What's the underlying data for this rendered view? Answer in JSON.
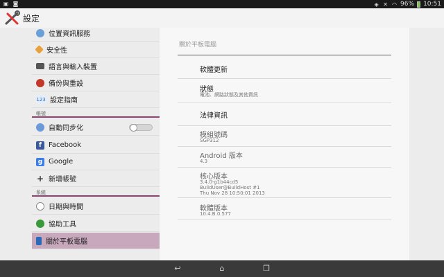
{
  "status_bar": {
    "battery_percent": "96%",
    "time": "10:51",
    "battery_level": 0.96
  },
  "action_bar": {
    "title": "設定",
    "icon": "settings-tools-icon"
  },
  "sidebar": {
    "items_top": [
      {
        "label": "位置資訊服務",
        "icon": "location-icon"
      },
      {
        "label": "安全性",
        "icon": "security-icon"
      },
      {
        "label": "語言與輸入裝置",
        "icon": "keyboard-icon"
      },
      {
        "label": "備份與重設",
        "icon": "backup-icon"
      },
      {
        "label": "設定指南",
        "icon": "guide-icon",
        "icon_text": "123"
      }
    ],
    "accounts_header": "帳號",
    "auto_sync_label": "自動同步化",
    "accounts": [
      {
        "label": "Facebook",
        "icon": "facebook-icon",
        "icon_text": "f",
        "color": "#3b5998"
      },
      {
        "label": "Google",
        "icon": "google-icon",
        "icon_text": "g",
        "color": "#3d7ee6"
      },
      {
        "label": "新增帳號",
        "icon": "add-icon",
        "icon_text": "+"
      }
    ],
    "system_header": "系統",
    "system": [
      {
        "label": "日期與時間",
        "icon": "clock-icon"
      },
      {
        "label": "協助工具",
        "icon": "accessibility-icon"
      },
      {
        "label": "關於平板電腦",
        "icon": "tablet-icon",
        "selected": true
      }
    ],
    "accent_color": "#8a4470",
    "selected_color": "#c8a8bd"
  },
  "panel": {
    "heading": "關於平板電腦",
    "rows": [
      {
        "title": "軟體更新"
      },
      {
        "title": "狀態",
        "subtitle": "電池、網路狀態及其他資訊"
      },
      {
        "title": "法律資訊"
      },
      {
        "title": "模組號碼",
        "subtitle": "SGP312"
      },
      {
        "title": "Android 版本",
        "subtitle": "4.3"
      },
      {
        "title": "核心版本",
        "subtitle": "3.4.0-g1b44cd5",
        "subtitle2": "BuildUser@BuildHost #1",
        "subtitle3": "Thu Nov 28 10:50:01 2013"
      },
      {
        "title": "軟體版本",
        "subtitle": "10.4.B.0.577"
      }
    ]
  },
  "nav_bar": {
    "back": "back-icon",
    "home": "home-icon",
    "recents": "recents-icon"
  }
}
